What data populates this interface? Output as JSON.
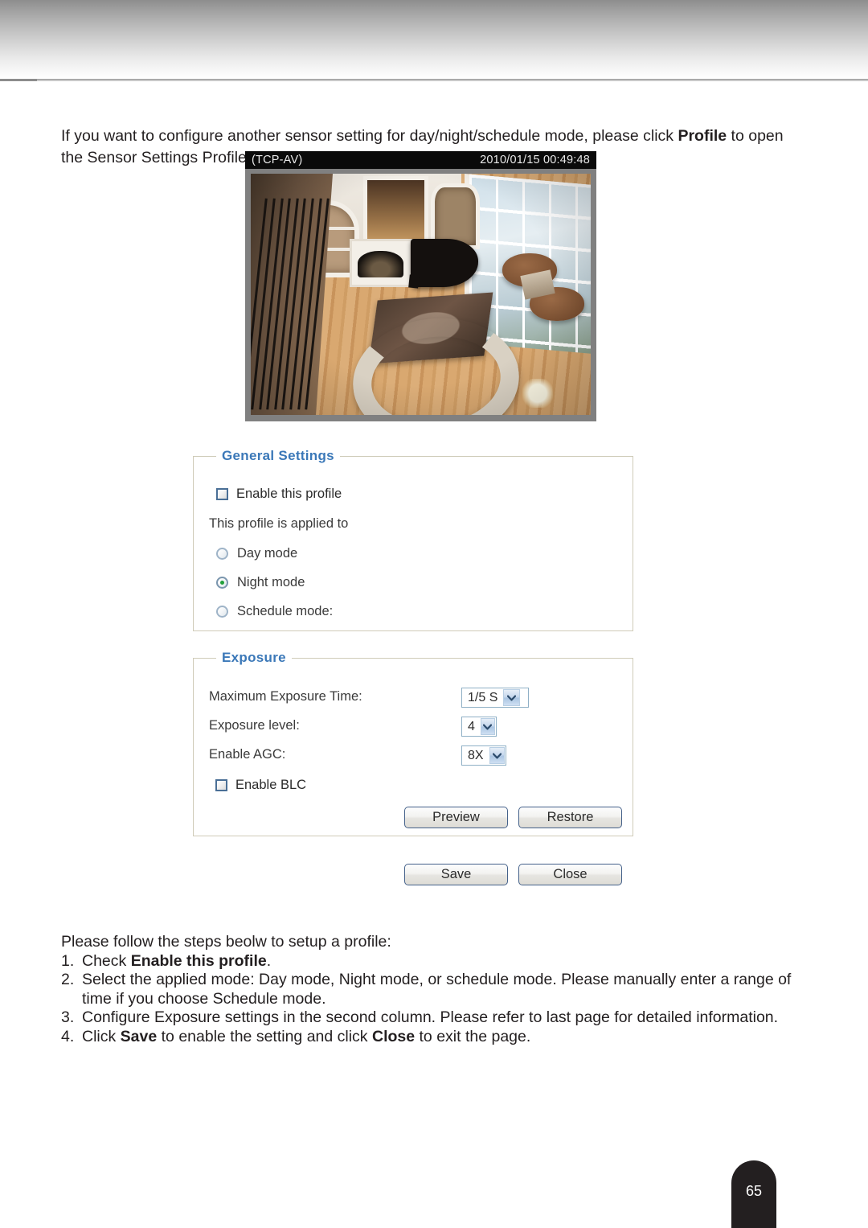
{
  "document": {
    "page_number": "65"
  },
  "intro": {
    "before_bold": "If you want to configure another sensor setting for day/night/schedule mode, please click ",
    "bold": "Profile",
    "after_bold": " to open the Sensor Settings Profile Settings page as shown below."
  },
  "video": {
    "stream_label": "(TCP-AV)",
    "timestamp": "2010/01/15 00:49:48"
  },
  "general_settings": {
    "legend": "General Settings",
    "enable_profile_label": "Enable this profile",
    "enable_profile_checked": false,
    "applied_to_label": "This profile is applied to",
    "modes": [
      {
        "label": "Day mode",
        "selected": false
      },
      {
        "label": "Night mode",
        "selected": true
      },
      {
        "label": "Schedule mode:",
        "selected": false
      }
    ]
  },
  "exposure": {
    "legend": "Exposure",
    "fields": [
      {
        "label": "Maximum Exposure Time:",
        "value": "1/5 S"
      },
      {
        "label": "Exposure level:",
        "value": "4"
      },
      {
        "label": "Enable AGC:",
        "value": "8X"
      }
    ],
    "enable_blc_label": "Enable BLC",
    "enable_blc_checked": false,
    "preview_label": "Preview",
    "restore_label": "Restore"
  },
  "actions": {
    "save_label": "Save",
    "close_label": "Close"
  },
  "steps": {
    "lead": "Please follow the steps beolw to setup a profile:",
    "items": [
      {
        "num": "1.",
        "parts": [
          {
            "t": " Check ",
            "b": false
          },
          {
            "t": "Enable this profile",
            "b": true
          },
          {
            "t": ".",
            "b": false
          }
        ]
      },
      {
        "num": "2.",
        "parts": [
          {
            "t": " Select the applied mode: Day mode, Night mode, or schedule mode. Please manually enter a range of time if you choose Schedule mode.",
            "b": false
          }
        ]
      },
      {
        "num": "3.",
        "parts": [
          {
            "t": " Configure Exposure settings in the second column. Please refer to last page for detailed information.",
            "b": false
          }
        ]
      },
      {
        "num": "4.",
        "parts": [
          {
            "t": " Click ",
            "b": false
          },
          {
            "t": "Save",
            "b": true
          },
          {
            "t": " to enable the setting and click ",
            "b": false
          },
          {
            "t": "Close",
            "b": true
          },
          {
            "t": " to exit the page.",
            "b": false
          }
        ]
      }
    ]
  },
  "colors": {
    "legend_blue": "#3b78b8",
    "radio_selected_green": "#22a03c",
    "page_tab_dark": "#231f20"
  }
}
